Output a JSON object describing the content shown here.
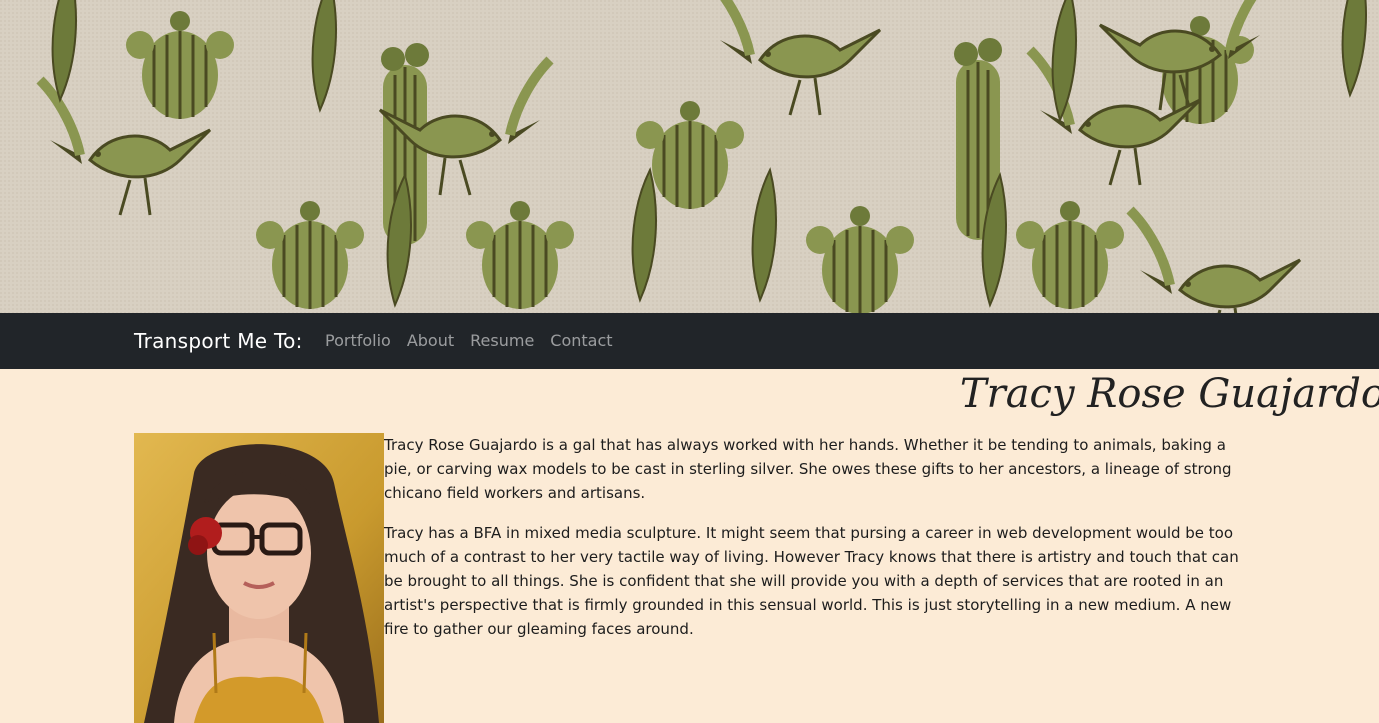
{
  "hero": {
    "image": "cactus-roadrunner-pattern-banner",
    "colors": {
      "background": "#d9d1c4",
      "green": "#8a9650",
      "dark": "#4a4a22"
    }
  },
  "navbar": {
    "brand": "Transport Me To:",
    "links": [
      "Portfolio",
      "About",
      "Resume",
      "Contact"
    ],
    "background": "#212529"
  },
  "main": {
    "name": "Tracy Rose Guajardo",
    "photo": "portrait-photo",
    "paragraphs": [
      "Tracy Rose Guajardo is a gal that has always worked with her hands. Whether it be tending to animals, baking a pie, or carving wax models to be cast in sterling silver. She owes these gifts to her ancestors, a lineage of strong chicano field workers and artisans.",
      "Tracy has a BFA in mixed media sculpture. It might seem that pursing a career in web development would be too much of a contrast to her very tactile way of living. However Tracy knows that there is artistry and touch that can be brought to all things. She is confident that she will provide you with a depth of services that are rooted in an artist's perspective that is firmly grounded in this sensual world. This is just storytelling in a new medium. A new fire to gather our gleaming faces around."
    ],
    "background": "#fcebd6"
  }
}
